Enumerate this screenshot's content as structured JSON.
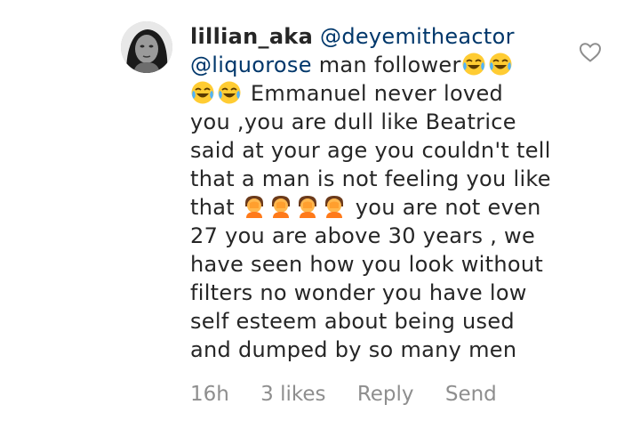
{
  "comment": {
    "username": "lillian_aka",
    "mention1": "@deyemitheactor",
    "mention2": "@liquorose",
    "text_line2": " man follower",
    "text_line3": " Emmanuel never loved",
    "text_line4": "you ,you are dull like Beatrice",
    "text_line5": "said at your age you couldn't tell",
    "text_line6": "that a man is not feeling you like",
    "text_line7_start": "that ",
    "text_line7_end": " you are not even",
    "text_line8": "27 you are above 30 years , we",
    "text_line9": "have seen how you look without",
    "text_line10": "filters no wonder you have low",
    "text_line11": "self esteem about being used",
    "text_line12": "and dumped by so many men",
    "emojis": [
      "face-with-tears-of-joy-emoji",
      "face-palm-emoji"
    ]
  },
  "meta": {
    "time": "16h",
    "likes": "3 likes",
    "reply": "Reply",
    "send": "Send"
  },
  "colors": {
    "text": "#262626",
    "mention": "#00376b",
    "meta": "#8e8e8e"
  }
}
